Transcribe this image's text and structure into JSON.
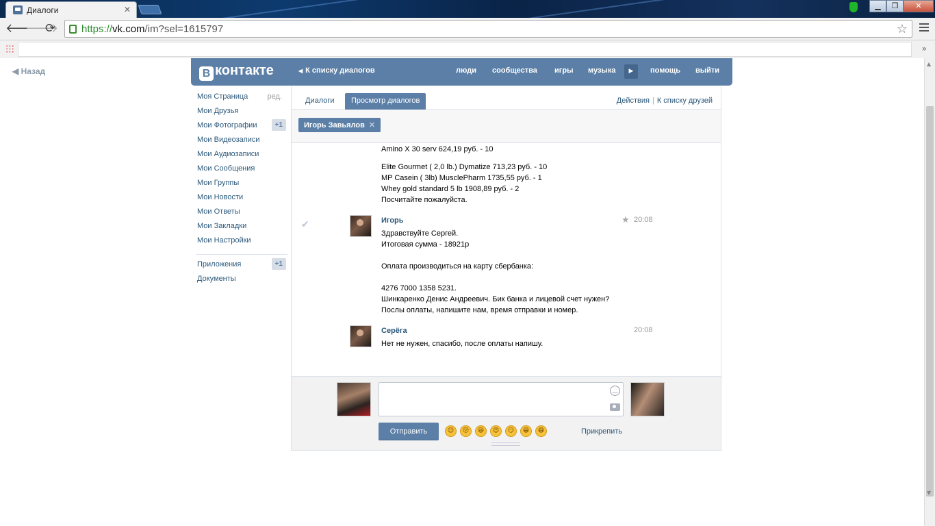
{
  "browser": {
    "tab_title": "Диалоги",
    "tab_close": "✕",
    "url_scheme": "https://",
    "url_host": "vk.com",
    "url_path": "/im?sel=1615797",
    "win_min": "▁",
    "win_max": "❐",
    "win_close": "✕"
  },
  "page": {
    "back_label": "Назад",
    "logo_mark": "В",
    "logo_text": "контакте",
    "header_back": "К списку диалогов",
    "topnav": [
      "люди",
      "сообщества",
      "игры",
      "музыка",
      "помощь",
      "выйти"
    ]
  },
  "leftnav": {
    "items": [
      {
        "label": "Моя Страница",
        "extra": "ред."
      },
      {
        "label": "Мои Друзья"
      },
      {
        "label": "Мои Фотографии",
        "badge": "+1"
      },
      {
        "label": "Мои Видеозаписи"
      },
      {
        "label": "Мои Аудиозаписи"
      },
      {
        "label": "Мои Сообщения"
      },
      {
        "label": "Мои Группы"
      },
      {
        "label": "Мои Новости"
      },
      {
        "label": "Мои Ответы"
      },
      {
        "label": "Мои Закладки"
      },
      {
        "label": "Мои Настройки"
      }
    ],
    "extra_items": [
      {
        "label": "Приложения",
        "badge": "+1"
      },
      {
        "label": "Документы"
      }
    ]
  },
  "tabs": {
    "dialogs": "Диалоги",
    "view": "Просмотр диалогов",
    "actions": "Действия",
    "separator": "|",
    "friends": "К списку друзей"
  },
  "peer": {
    "name": "Игорь Завьялов",
    "close": "✕"
  },
  "messages": {
    "prev_lines": [
      "Amino X 30 serv 624,19 руб. - 10",
      "Elite Gourmet ( 2,0 lb.) Dymatize 713,23 руб. - 10",
      "MP Casein ( 3lb) MusclePharm 1735,55 руб. - 1",
      "Whey gold standard 5 lb 1908,89 руб. - 2",
      "Посчитайте пожалуйста."
    ],
    "msg1": {
      "author": "Игорь",
      "time": "20:08",
      "lines": [
        "Здравствуйте Сергей.",
        "Итоговая сумма - 18921р",
        "Оплата производиться на карту сбербанка:",
        "4276 7000 1358 5231.",
        "Шинкаренко Денис Андреевич. Бик банка и лицевой счет нужен?",
        "Послы оплаты, напишите нам, время отправки и номер."
      ]
    },
    "msg2": {
      "author": "Серёга",
      "time": "20:08",
      "lines": [
        "Нет не нужен, спасибо, после оплаты напишу."
      ]
    }
  },
  "composer": {
    "send_label": "Отправить",
    "attach_label": "Прикрепить",
    "emojis": [
      "😊",
      "😚",
      "😆",
      "😍",
      "😏",
      "😁",
      "😷"
    ]
  }
}
